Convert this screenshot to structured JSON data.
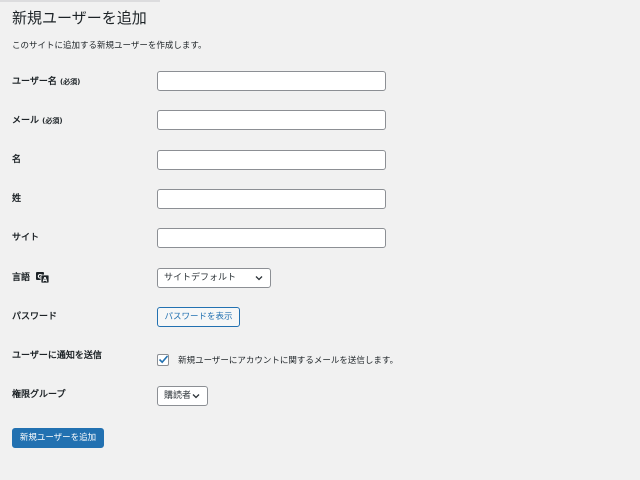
{
  "page": {
    "title": "新規ユーザーを追加",
    "description": "このサイトに追加する新規ユーザーを作成します。"
  },
  "form": {
    "username": {
      "label": "ユーザー名",
      "required": "(必須)",
      "value": ""
    },
    "email": {
      "label": "メール",
      "required": "(必須)",
      "value": ""
    },
    "first_name": {
      "label": "名",
      "value": ""
    },
    "last_name": {
      "label": "姓",
      "value": ""
    },
    "website": {
      "label": "サイト",
      "value": ""
    },
    "language": {
      "label": "言語",
      "selected": "サイトデフォルト",
      "icon": "translation-icon"
    },
    "password": {
      "label": "パスワード",
      "button_label": "パスワードを表示"
    },
    "notify": {
      "label": "ユーザーに通知を送信",
      "checkbox_text": "新規ユーザーにアカウントに関するメールを送信します。",
      "checked": true
    },
    "role": {
      "label": "権限グループ",
      "selected": "購読者"
    },
    "submit_label": "新規ユーザーを追加"
  },
  "colors": {
    "accent": "#2271b1",
    "background": "#f1f1f1",
    "text": "#1d2327",
    "border": "#8c8f94"
  }
}
